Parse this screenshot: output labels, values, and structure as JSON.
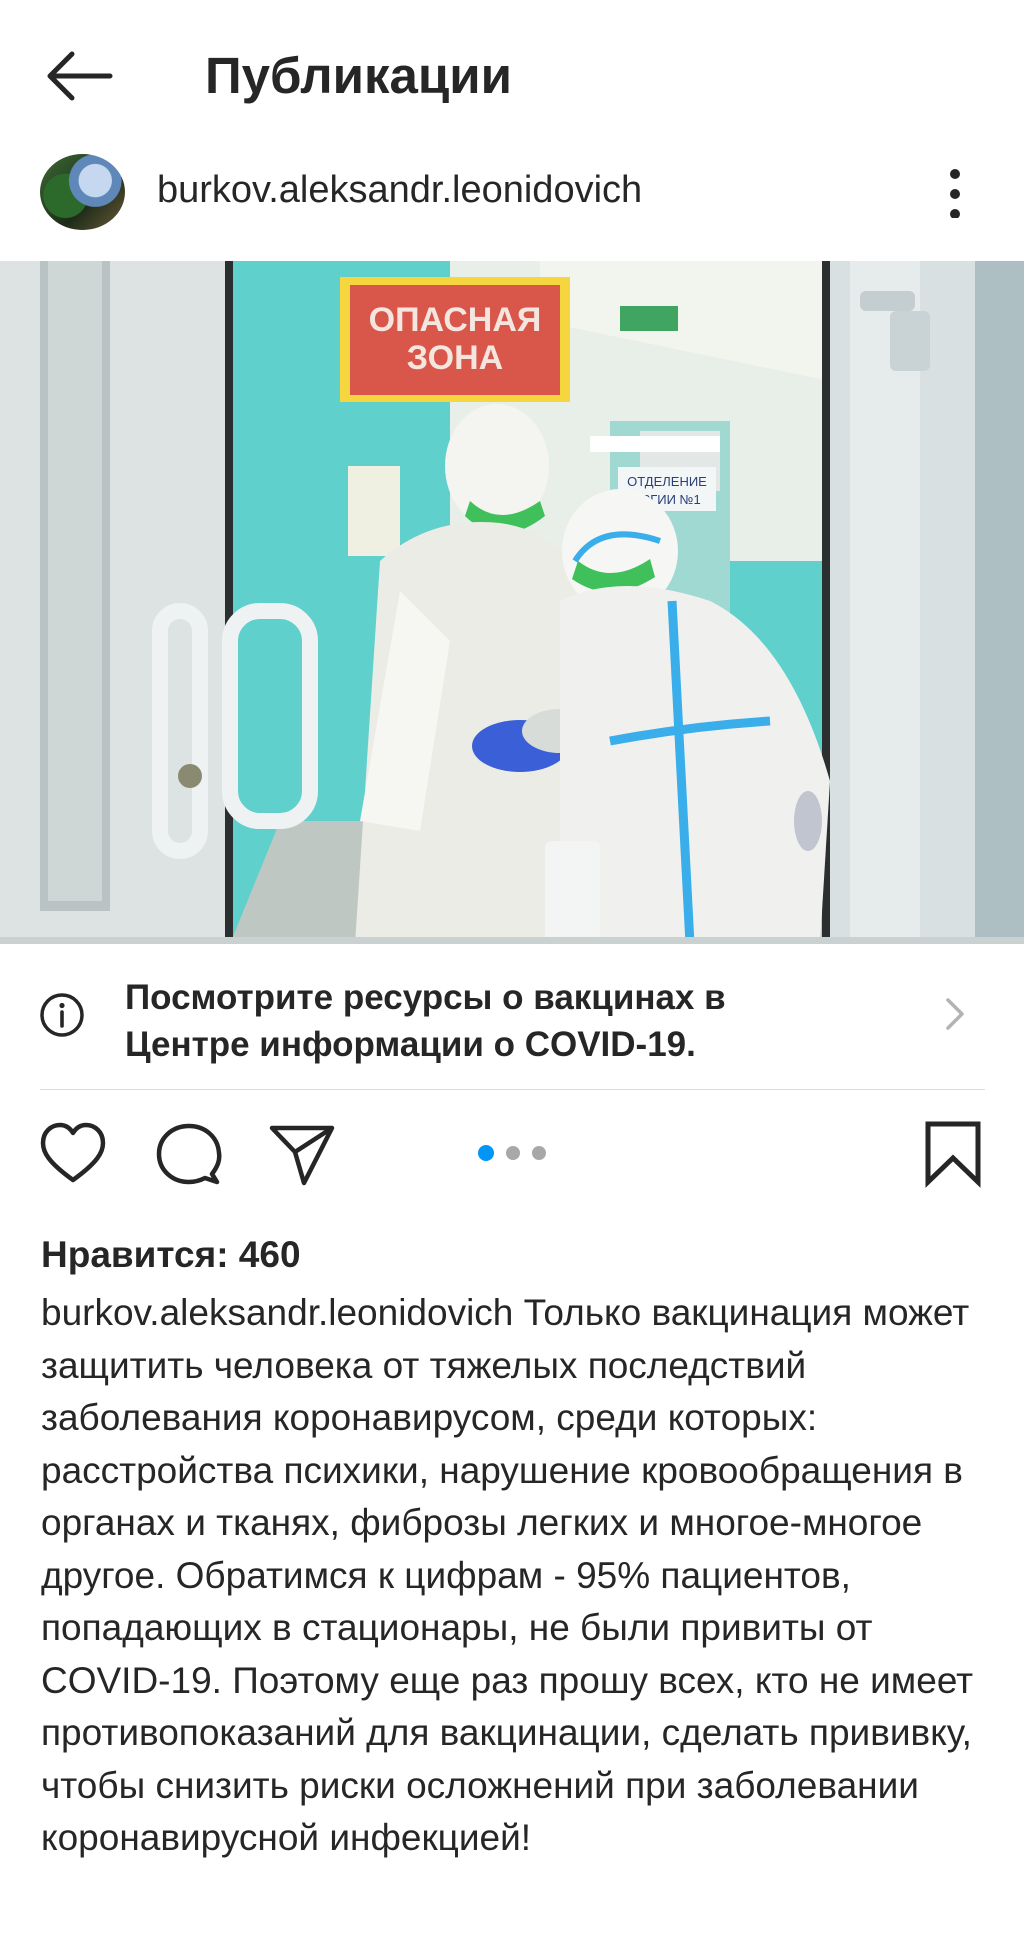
{
  "header": {
    "title": "Публикации",
    "back_icon": "arrow-left-icon"
  },
  "post": {
    "username": "burkov.aleksandr.leonidovich",
    "more_icon": "vertical-ellipsis-icon",
    "image": {
      "sign_text_line1": "ОПАСНАЯ",
      "sign_text_line2": "ЗОНА",
      "hall_sign_line1": "ОТДЕЛЕНИЕ",
      "hall_sign_line2": "УРГИИ №1"
    },
    "info_banner": {
      "text": "Посмотрите ресурсы о вакцинах в Центре информации о COVID-19.",
      "icon": "info-circle-icon",
      "chevron": "chevron-right-icon"
    },
    "actions": {
      "like_icon": "heart-icon",
      "comment_icon": "comment-bubble-icon",
      "share_icon": "paper-plane-icon",
      "save_icon": "bookmark-icon"
    },
    "carousel": {
      "total": 3,
      "active_index": 0,
      "active_color": "#0095f6",
      "inactive_color": "#a8a8a8"
    },
    "likes_text": "Нравится: 460",
    "caption_author": "burkov.aleksandr.leonidovich",
    "caption_text": "Только вакцинация может защитить человека от тяжелых последствий заболевания коронавирусом, среди которых: расстройства психики, нарушение кровообращения в органах и тканях, фиброзы легких и многое-многое другое. Обратимся к цифрам - 95% пациентов, попадающих в стационары, не были привиты от COVID-19. Поэтому еще раз прошу всех, кто не имеет противопоказаний для вакцинации, сделать прививку, чтобы снизить риски осложнений при заболевании коронавирусной инфекцией!"
  }
}
